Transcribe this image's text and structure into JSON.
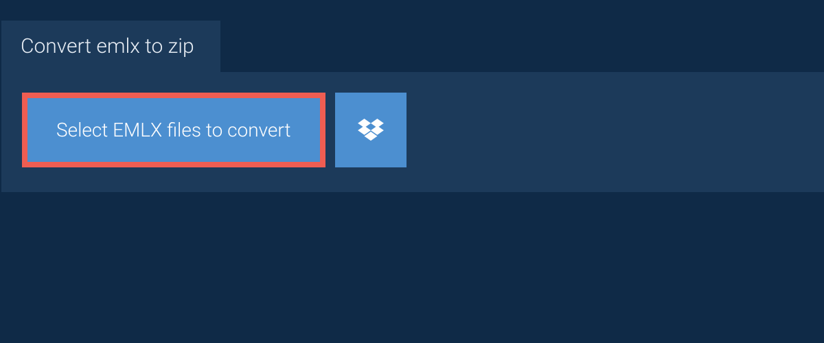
{
  "header": {
    "title": "Convert emlx to zip"
  },
  "actions": {
    "select_files_label": "Select EMLX files to convert"
  },
  "colors": {
    "page_bg": "#0f2a47",
    "panel_bg": "#1c3a5a",
    "button_bg": "#4c8fd0",
    "highlight_border": "#ef5d52",
    "text_light": "#e8eef5"
  }
}
